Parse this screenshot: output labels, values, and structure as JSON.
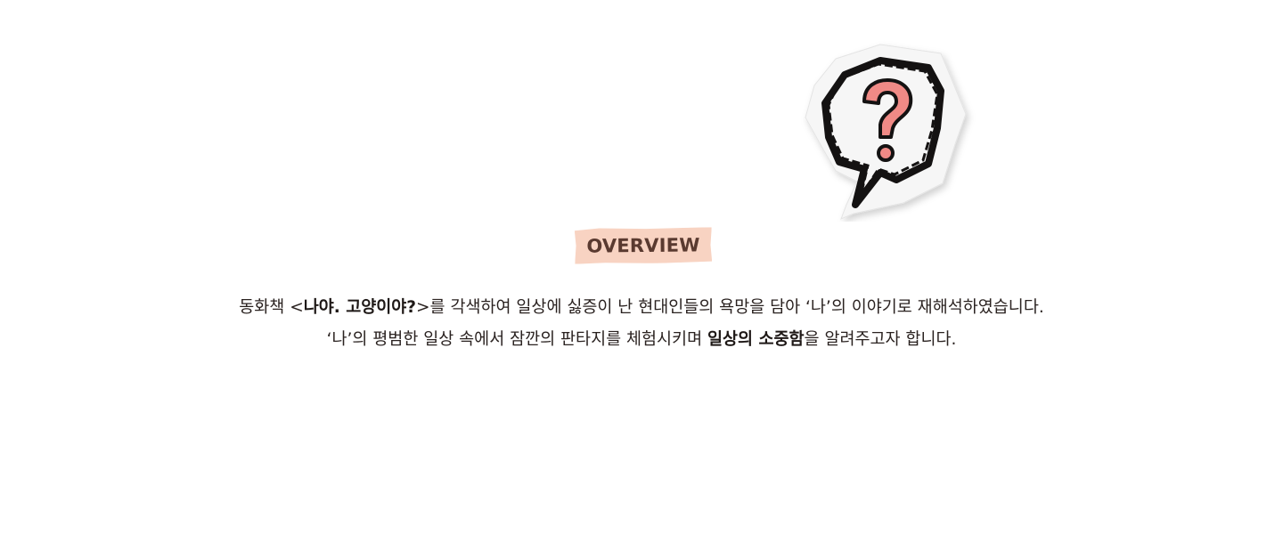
{
  "sticker": {
    "icon": "question-speech-bubble-icon",
    "colors": {
      "paper": "#f6f6f6",
      "outline": "#141212",
      "mark_fill": "#f08a86"
    }
  },
  "overview": {
    "label": "OVERVIEW",
    "tag_color": "#f8d3c2",
    "text_color": "#5a3a30"
  },
  "description": {
    "line1": {
      "a": "동화책 <",
      "b_bold": "나야. 고양이야?",
      "c": ">를 각색하여 일상에 싫증이 난 현대인들의 욕망을 담아 ‘나’의 이야기로 재해석하였습니다."
    },
    "line2": {
      "a": "‘나’의 평범한 일상 속에서 잠깐의 판타지를 체험시키며 ",
      "b_bold": "일상의 소중함",
      "c": "을 알려주고자 합니다."
    }
  }
}
